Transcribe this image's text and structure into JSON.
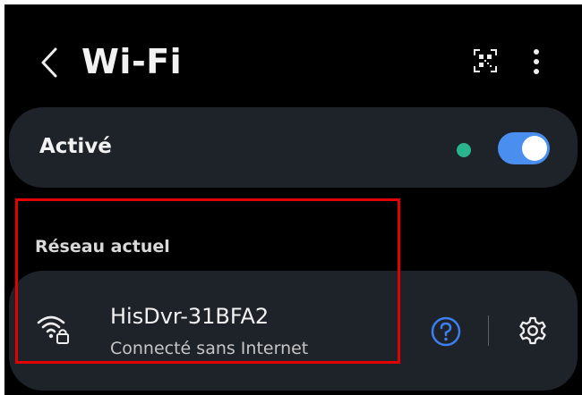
{
  "header": {
    "title": "Wi-Fi",
    "back_icon": "chevron-left-icon",
    "qr_icon": "qr-code-scan-icon",
    "more_icon": "more-vertical-icon"
  },
  "wifi_toggle": {
    "label": "Activé",
    "enabled": true,
    "status_color": "#29b48d",
    "accent_color": "#4a8ef0"
  },
  "current_network": {
    "section_label": "Réseau actuel",
    "name": "HisDvr-31BFA2",
    "status": "Connecté sans Internet",
    "signal_icon": "wifi-locked-icon",
    "help_icon": "help-circle-icon",
    "settings_icon": "gear-icon",
    "help_color": "#3d7ff0"
  },
  "annotation": {
    "highlight_color": "#e30000"
  }
}
